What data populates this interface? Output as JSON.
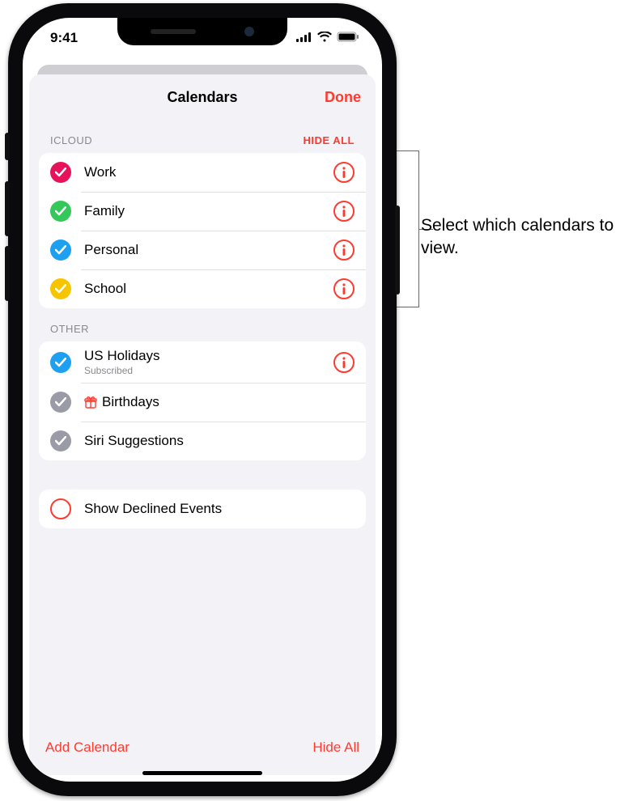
{
  "status": {
    "time": "9:41"
  },
  "nav": {
    "title": "Calendars",
    "done": "Done"
  },
  "sections": [
    {
      "title": "ICLOUD",
      "hide_all": "HIDE ALL",
      "rows": [
        {
          "label": "Work",
          "color": "#e6135a",
          "checked": true,
          "info": true
        },
        {
          "label": "Family",
          "color": "#34c759",
          "checked": true,
          "info": true
        },
        {
          "label": "Personal",
          "color": "#1ea0f2",
          "checked": true,
          "info": true
        },
        {
          "label": "School",
          "color": "#f7c500",
          "checked": true,
          "info": true
        }
      ]
    },
    {
      "title": "OTHER",
      "rows": [
        {
          "label": "US Holidays",
          "sub": "Subscribed",
          "color": "#1ea0f2",
          "checked": true,
          "info": true
        },
        {
          "label": "Birthdays",
          "color": "#9b9ba7",
          "checked": true,
          "gift": true
        },
        {
          "label": "Siri Suggestions",
          "color": "#9b9ba7",
          "checked": true
        }
      ]
    }
  ],
  "declined": {
    "label": "Show Declined Events",
    "color": "#ff3b30",
    "checked": false
  },
  "toolbar": {
    "add": "Add Calendar",
    "hide_all": "Hide All"
  },
  "callout": "Select which calendars to view."
}
